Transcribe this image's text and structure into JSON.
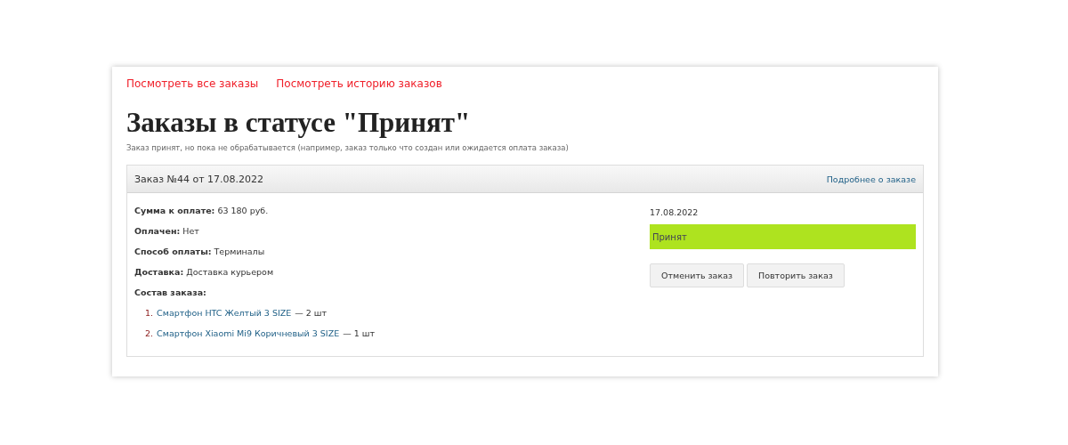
{
  "nav_links": [
    "Посмотреть все заказы",
    "Посмотреть историю заказов"
  ],
  "title": "Заказы в статусе \"Принят\"",
  "subtitle": "Заказ принят, но пока не обрабатывается (например, заказ только что создан или ожидается оплата заказа)",
  "order": {
    "header": "Заказ №44 от 17.08.2022",
    "details_link": "Подробнее о заказе",
    "fields": [
      "**Сумма к оплате:** 63 180 руб.",
      "**Оплачен:** Нет",
      "**Способ оплаты:** Терминалы",
      "**Доставка:** Доставка курьером"
    ],
    "items_label": "Состав заказа:",
    "items": [
      {
        "number": "1.",
        "name": "Смартфон HTC Желтый 3 SIZE",
        "quantity": "— 2 шт"
      },
      {
        "number": "2.",
        "name": "Смартфон Xiaomi Mi9 Коричневый 3 SIZE",
        "quantity": "— 1 шт"
      }
    ],
    "date": "17.08.2022",
    "status": {
      "label": "Принят",
      "color": "#aee31f"
    },
    "buttons": [
      "Отменить заказ",
      "Повторить заказ"
    ]
  }
}
